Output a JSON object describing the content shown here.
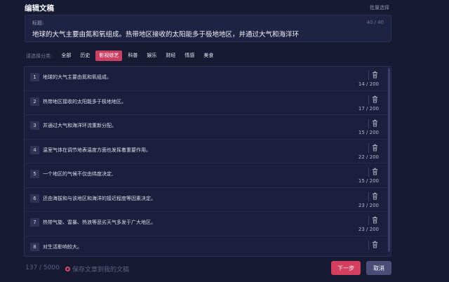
{
  "header": {
    "title": "编辑文稿",
    "batch_select": "批量选择"
  },
  "title_card": {
    "label": "标题:",
    "char_count": "40 / 40",
    "text": "地球的大气主要由氮和氧组成。热带地区接收的太阳能多于极地地区，并通过大气和海洋环"
  },
  "categories": {
    "prompt": "请选择分类:",
    "selected": "影视综艺",
    "items": [
      "全部",
      "历史",
      "影视综艺",
      "科普",
      "娱乐",
      "财经",
      "情感",
      "美食"
    ]
  },
  "sentences": [
    {
      "index": "1",
      "text": "地球的大气主要由氮和氧组成。",
      "count": "14 / 200"
    },
    {
      "index": "2",
      "text": "热带地区接收的太阳能多于极地地区。",
      "count": "17 / 200"
    },
    {
      "index": "3",
      "text": "并通过大气和海洋环流重新分配。",
      "count": "15 / 200"
    },
    {
      "index": "4",
      "text": "温室气体在调节地表温度方面也发挥着重要作用。",
      "count": "22 / 200"
    },
    {
      "index": "5",
      "text": "一个地区的气候不仅由纬度决定,",
      "count": "15 / 200"
    },
    {
      "index": "6",
      "text": "还由海拔和与该地区和海洋的接近程度等因素决定。",
      "count": "23 / 200"
    },
    {
      "index": "7",
      "text": "热带气旋、雷暴、热浪等恶劣天气多发于广大地区。",
      "count": "23 / 200"
    },
    {
      "index": "8",
      "text": "对生活影响较大。",
      "count": ""
    }
  ],
  "footer": {
    "total_count": "137 / 5000",
    "save_label": "保存文章到我的文稿",
    "next_label": "下一步",
    "cancel_label": "取消"
  },
  "colors": {
    "background": "#171a33",
    "accent": "#d43e5f",
    "cancel": "#4a4d78",
    "panel": "#1b1f3d"
  },
  "icons": {
    "delete": "trash-icon"
  }
}
